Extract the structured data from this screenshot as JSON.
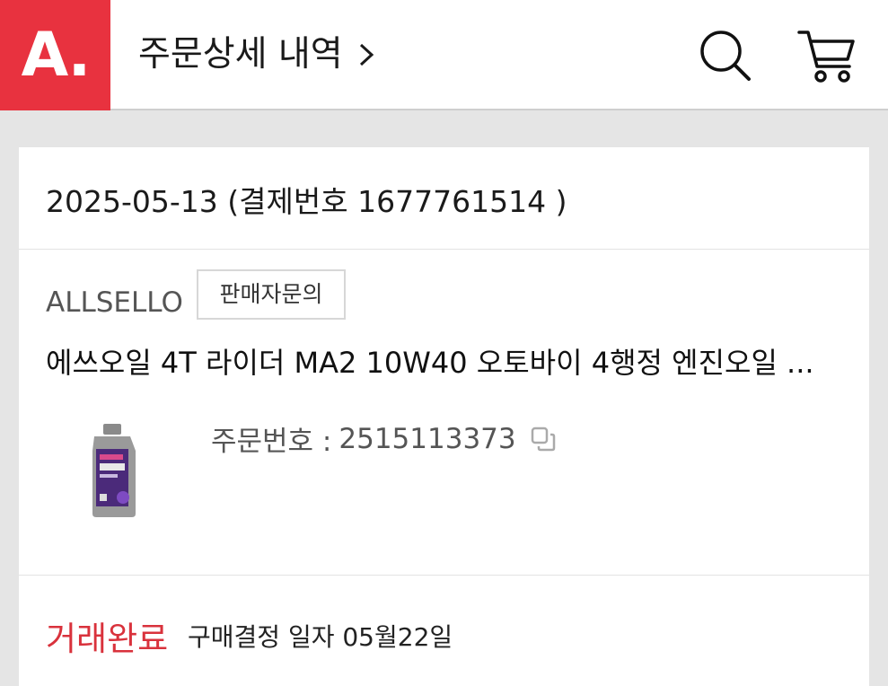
{
  "header": {
    "logo_text": "A.",
    "title": "주문상세 내역",
    "brand_color": "#e8323f",
    "icons": {
      "search": "search-icon",
      "cart": "cart-icon",
      "chevron": "chevron-right-icon"
    }
  },
  "order": {
    "date": "2025-05-13",
    "payment_label": "결제번호",
    "payment_no": "1677761514",
    "seller": "ALLSELLO",
    "inquiry_button": "판매자문의",
    "product_name": "에쓰오일 4T 라이더 MA2 10W40 오토바이 4행정 엔진오일 ...",
    "order_no_label": "주문번호 :",
    "order_no": "2515113373",
    "copy_icon": "copy-icon",
    "status": "거래완료",
    "status_color": "#d9323c",
    "confirm_text": "구매결정 일자 05월22일"
  }
}
